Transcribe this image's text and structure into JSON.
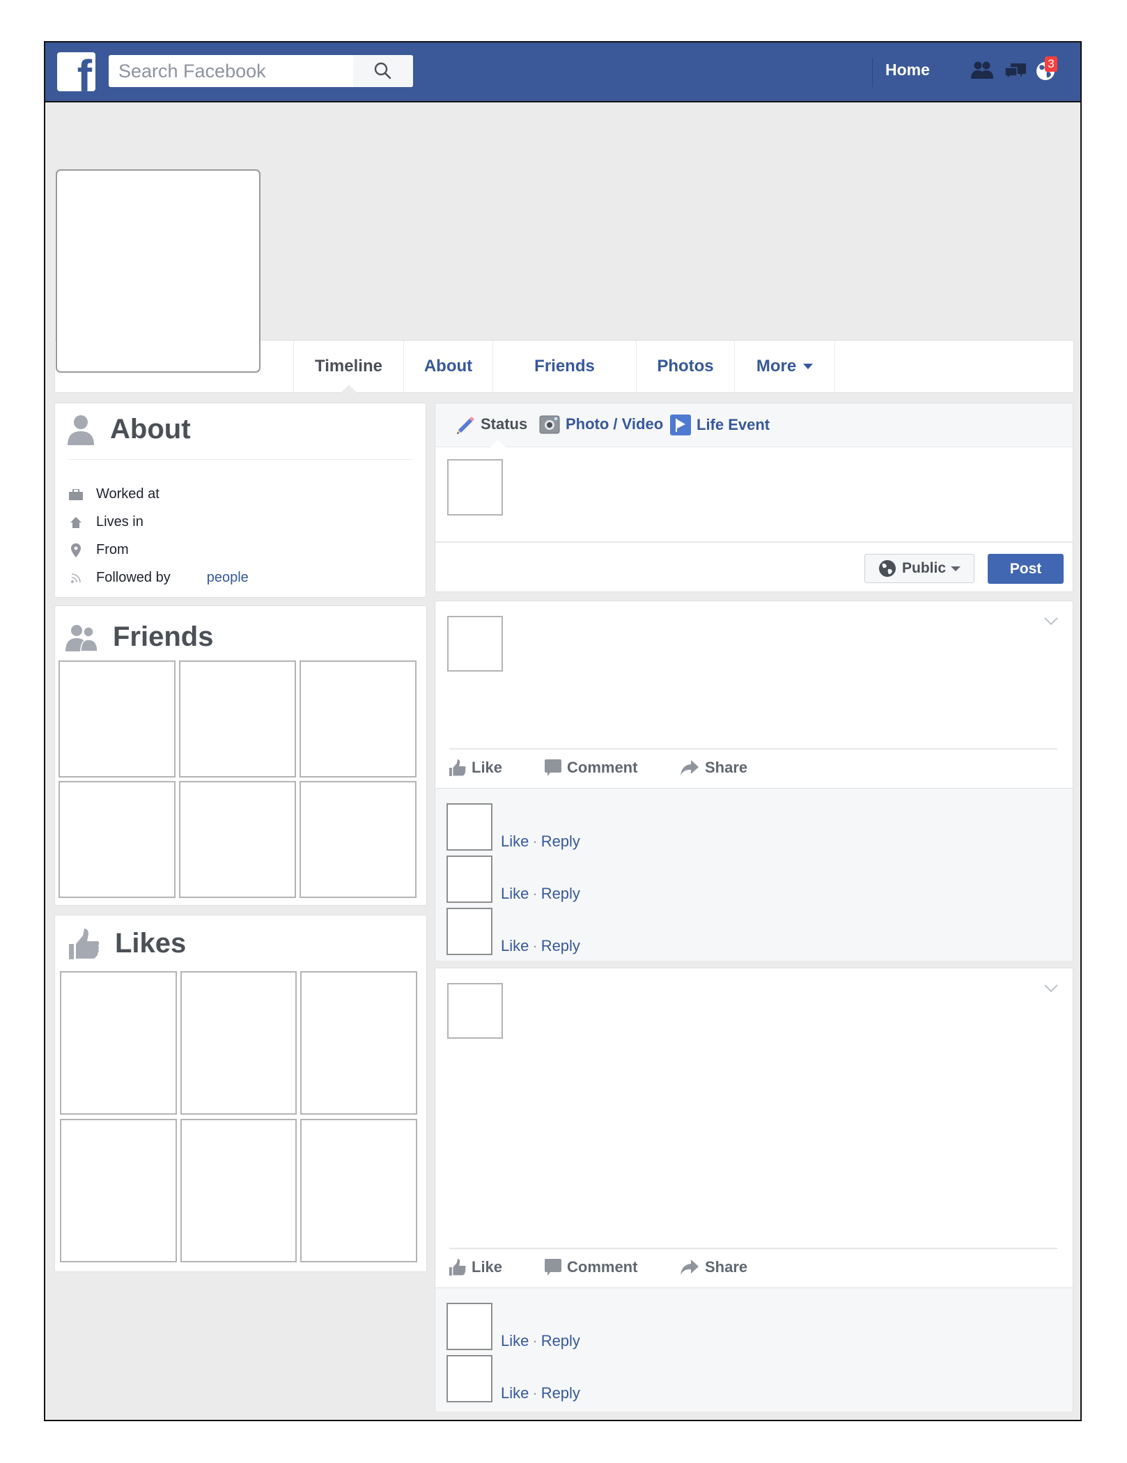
{
  "header": {
    "logo_letter": "f",
    "search_placeholder": "Search Facebook",
    "search_value": "",
    "home_label": "Home",
    "notification_count": "3",
    "brand_color": "#3b5998"
  },
  "tabs": [
    {
      "label": "Timeline",
      "active": true
    },
    {
      "label": "About",
      "active": false
    },
    {
      "label": "Friends",
      "active": false
    },
    {
      "label": "Photos",
      "active": false
    },
    {
      "label": "More",
      "active": false,
      "dropdown": true
    }
  ],
  "about": {
    "title": "About",
    "rows": [
      {
        "icon": "briefcase-icon",
        "label": "Worked at"
      },
      {
        "icon": "home-icon",
        "label": "Lives in"
      },
      {
        "icon": "location-pin-icon",
        "label": "From"
      },
      {
        "icon": "rss-feed-icon",
        "label": "Followed by",
        "link": "people"
      }
    ]
  },
  "friends": {
    "title": "Friends",
    "tile_count": 6
  },
  "likes": {
    "title": "Likes",
    "tile_count": 6
  },
  "composer": {
    "tabs": [
      {
        "icon": "pencil-icon",
        "label": "Status",
        "active": true
      },
      {
        "icon": "camera-icon",
        "label": "Photo / Video",
        "active": false
      },
      {
        "icon": "flag-icon",
        "label": "Life Event",
        "active": false
      }
    ],
    "privacy_label": "Public",
    "post_label": "Post"
  },
  "posts": [
    {
      "actions": [
        "Like",
        "Comment",
        "Share"
      ],
      "comments": [
        {
          "like": "Like",
          "separator": "·",
          "reply": "Reply"
        },
        {
          "like": "Like",
          "separator": "·",
          "reply": "Reply"
        },
        {
          "like": "Like",
          "separator": "·",
          "reply": "Reply"
        }
      ]
    },
    {
      "actions": [
        "Like",
        "Comment",
        "Share"
      ],
      "comments": [
        {
          "like": "Like",
          "separator": "·",
          "reply": "Reply"
        },
        {
          "like": "Like",
          "separator": "·",
          "reply": "Reply"
        }
      ]
    }
  ]
}
